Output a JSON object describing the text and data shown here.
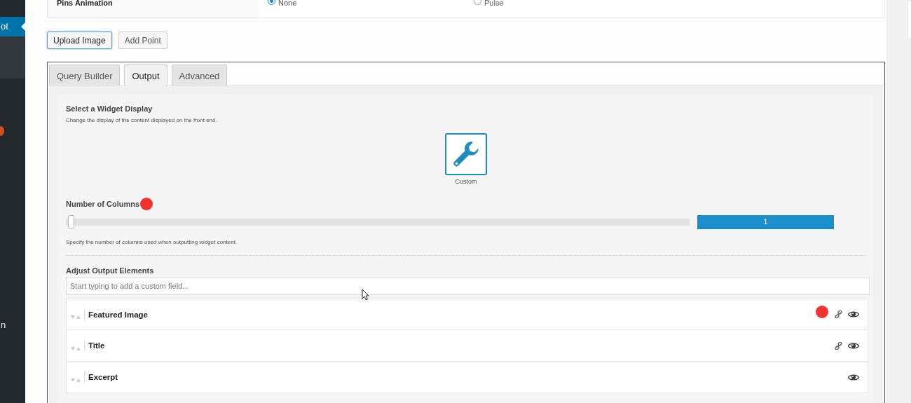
{
  "sidebar": {
    "items": [
      {
        "label": "ot",
        "selected": true
      },
      {
        "label": "n",
        "selected": false
      }
    ]
  },
  "pins_animation": {
    "label": "Pins Animation",
    "options": [
      {
        "label": "None",
        "selected": true
      },
      {
        "label": "Pulse",
        "selected": false
      }
    ]
  },
  "buttons": [
    {
      "label": "Upload Image",
      "focused": true
    },
    {
      "label": "Add Point",
      "focused": false
    }
  ],
  "tabs": [
    {
      "label": "Query Builder",
      "selected": false
    },
    {
      "label": "Output",
      "selected": true
    },
    {
      "label": "Advanced",
      "selected": false
    }
  ],
  "widget_display": {
    "heading": "Select a Widget Display",
    "description": "Change the display of the content displayed on the front end.",
    "options": [
      {
        "label": "Custom",
        "selected": true
      }
    ]
  },
  "columns": {
    "label": "Number of Columns",
    "level": 0,
    "value": "1",
    "help": "Specify the number of columns used when outputting widget content."
  },
  "output_elements": {
    "heading": "Adjust Output Elements",
    "placeholder": "Start typing to add a custom field...",
    "items": [
      {
        "label": "Featured Image",
        "link": true
      },
      {
        "label": "Title",
        "link": true
      },
      {
        "label": "Excerpt",
        "link": false
      }
    ]
  }
}
